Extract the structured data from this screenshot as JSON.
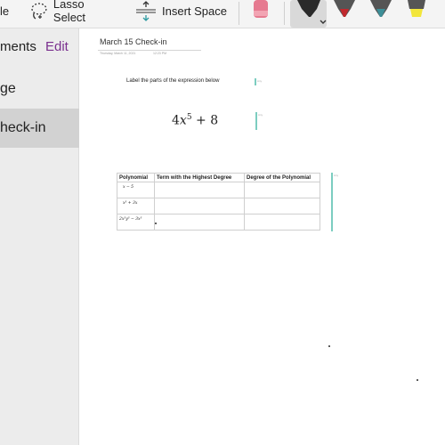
{
  "toolbar": {
    "partial_label": "le",
    "lasso_label": "Lasso Select",
    "insert_space_label": "Insert Space",
    "colors": {
      "eraser": "#e67a90",
      "pen_black": "#2a2a2a",
      "pen_red": "#c0282d",
      "pen_teal": "#3d8f98",
      "highlighter_yellow": "#f2e63b"
    }
  },
  "sidebar": {
    "title": "ments",
    "edit_label": "Edit",
    "items": [
      {
        "label": "ge"
      },
      {
        "label": "heck-in",
        "selected": true
      }
    ]
  },
  "page": {
    "title": "March 15 Check-in",
    "date": "Thursday, March 11, 2021",
    "time": "12:23 PM",
    "prompt": "Label the parts of the expression below",
    "expression": {
      "coefficient": "4",
      "variable": "x",
      "exponent": "5",
      "operator": "+",
      "constant": "8"
    },
    "tiny_label": "Any",
    "table": {
      "headers": [
        "Polynomial",
        "Term with the Highest Degree",
        "Degree of the Polynomial"
      ],
      "rows": [
        [
          "x − 5",
          "",
          ""
        ],
        [
          "x³ + 3x",
          "",
          ""
        ],
        [
          "2x⁵y³ − 3x³",
          "",
          ""
        ]
      ]
    }
  },
  "accent_color": "#7ccdc0"
}
